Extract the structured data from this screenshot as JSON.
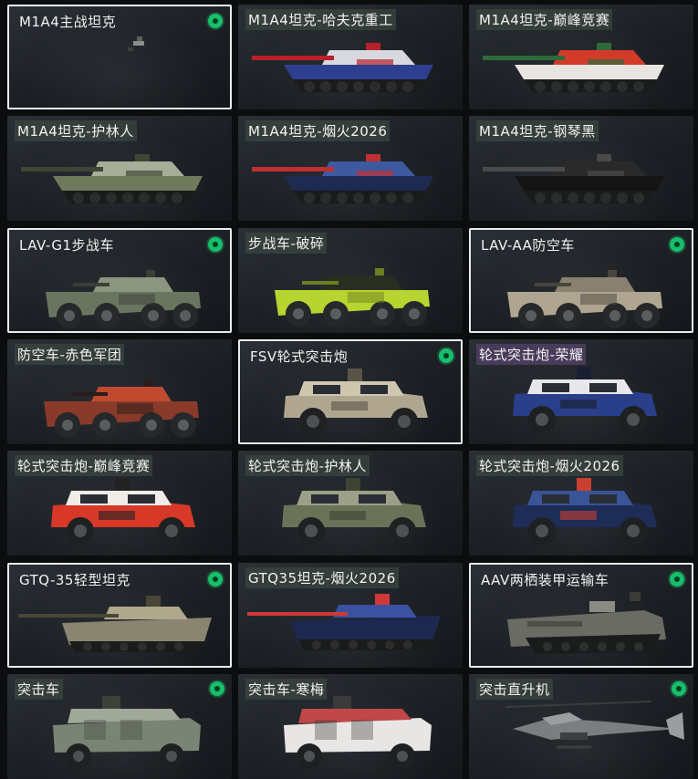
{
  "vehicles": [
    {
      "label": "M1A4主战坦克",
      "selected": true,
      "owned": true,
      "kind": "tiny",
      "palette": [
        "#8a8e8a",
        "#5c605c",
        "#3c3f3c"
      ]
    },
    {
      "label": "M1A4坦克-哈夫克重工",
      "selected": false,
      "owned": false,
      "kind": "tank",
      "palette": [
        "#2f3f8f",
        "#d8d8e0",
        "#b8202a"
      ]
    },
    {
      "label": "M1A4坦克-巅峰竞赛",
      "selected": false,
      "owned": false,
      "kind": "tank",
      "palette": [
        "#e8e4e0",
        "#d23a2a",
        "#2e6a3a"
      ]
    },
    {
      "label": "M1A4坦克-护林人",
      "selected": false,
      "owned": false,
      "kind": "tank",
      "palette": [
        "#6f7a5c",
        "#a8ad98",
        "#3e4636"
      ]
    },
    {
      "label": "M1A4坦克-烟火2026",
      "selected": false,
      "owned": false,
      "kind": "tank",
      "palette": [
        "#1e2a50",
        "#3d5aa0",
        "#c03030"
      ]
    },
    {
      "label": "M1A4坦克-钢琴黑",
      "selected": false,
      "owned": false,
      "kind": "tank",
      "palette": [
        "#151515",
        "#2a2a2a",
        "#4a4a4a"
      ]
    },
    {
      "label": "LAV-G1步战车",
      "selected": true,
      "owned": true,
      "kind": "apc",
      "palette": [
        "#6a7560",
        "#8b9580",
        "#3a3f36"
      ]
    },
    {
      "label": "步战车-破碎",
      "selected": false,
      "owned": false,
      "kind": "apc",
      "palette": [
        "#b8d430",
        "#2a2e22",
        "#6c8020"
      ]
    },
    {
      "label": "LAV-AA防空车",
      "selected": true,
      "owned": true,
      "kind": "apc",
      "palette": [
        "#b0a590",
        "#8a8070",
        "#4a453c"
      ]
    },
    {
      "label": "防空车-赤色军团",
      "selected": false,
      "owned": false,
      "kind": "apc",
      "palette": [
        "#8a3a2a",
        "#c04a30",
        "#2a1c18"
      ]
    },
    {
      "label": "FSV轮式突击炮",
      "selected": true,
      "owned": true,
      "kind": "car",
      "palette": [
        "#b0a690",
        "#cfc6b0",
        "#5a5448"
      ]
    },
    {
      "label": "轮式突击炮-荣耀",
      "selected": false,
      "owned": false,
      "kind": "car",
      "palette": [
        "#2a3f8a",
        "#e8e8ec",
        "#1a1e30"
      ]
    },
    {
      "label": "轮式突击炮-巅峰竞赛",
      "selected": false,
      "owned": false,
      "kind": "car",
      "palette": [
        "#d83828",
        "#f0ece8",
        "#222222"
      ]
    },
    {
      "label": "轮式突击炮-护林人",
      "selected": false,
      "owned": false,
      "kind": "car",
      "palette": [
        "#6a7258",
        "#9ca088",
        "#3e4434"
      ]
    },
    {
      "label": "轮式突击炮-烟火2026",
      "selected": false,
      "owned": false,
      "kind": "car",
      "palette": [
        "#1e2c58",
        "#3a5498",
        "#c84030"
      ]
    },
    {
      "label": "GTQ-35轻型坦克",
      "selected": true,
      "owned": true,
      "kind": "light",
      "palette": [
        "#8a8570",
        "#b0a88c",
        "#4a4638"
      ]
    },
    {
      "label": "GTQ35坦克-烟火2026",
      "selected": false,
      "owned": false,
      "kind": "light",
      "palette": [
        "#1c2850",
        "#3a52a0",
        "#d03838"
      ]
    },
    {
      "label": "AAV两栖装甲运输车",
      "selected": true,
      "owned": true,
      "kind": "aav",
      "palette": [
        "#6a6c64",
        "#8a8c84",
        "#3a3c36"
      ]
    },
    {
      "label": "突击车",
      "selected": false,
      "owned": true,
      "kind": "mrap",
      "palette": [
        "#7a8474",
        "#a0a898",
        "#3c423a"
      ]
    },
    {
      "label": "突击车-寒梅",
      "selected": false,
      "owned": false,
      "kind": "mrap",
      "palette": [
        "#e8e6e4",
        "#c04848",
        "#3a3a3a"
      ]
    },
    {
      "label": "突击直升机",
      "selected": false,
      "owned": true,
      "kind": "heli",
      "palette": [
        "#7a7e80",
        "#9a9ea0",
        "#3c3e40"
      ]
    }
  ]
}
